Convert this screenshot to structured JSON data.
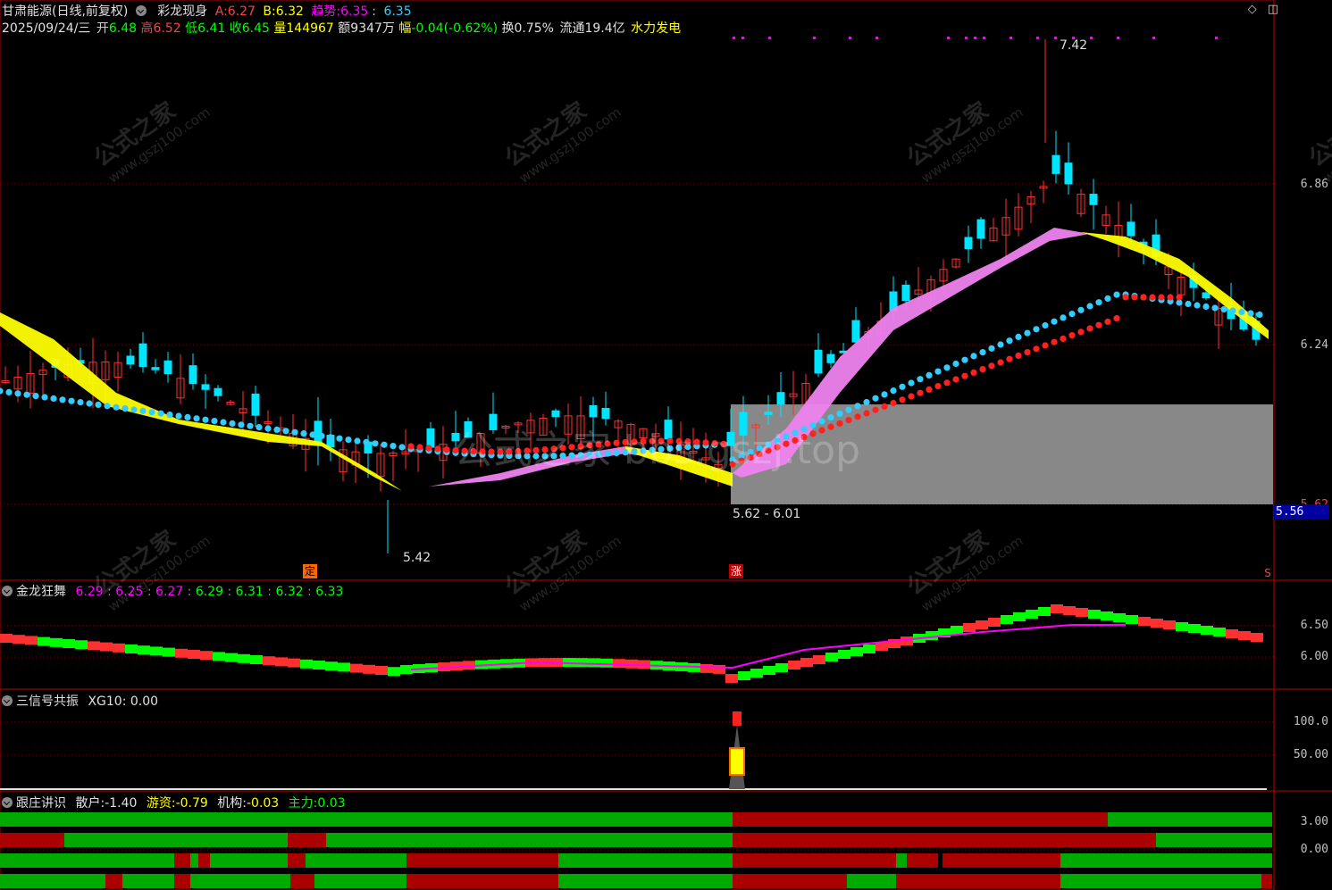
{
  "header": {
    "stock_name": "甘肃能源(日线,前复权)",
    "indicator": "彩龙现身",
    "a_label": "A:",
    "a_value": "6.27",
    "b_label": "B:",
    "b_value": "6.32",
    "trend_label": "趋势:",
    "trend_v1": "6.35",
    "trend_v2": "6.35",
    "date": "2025/09/24/三",
    "open_label": "开",
    "open": "6.48",
    "high_label": "高",
    "high": "6.52",
    "low_label": "低",
    "low": "6.41",
    "close_label": "收",
    "close": "6.45",
    "vol_label": "量",
    "vol": "144967",
    "amt": "额9347万",
    "chg_label": "幅",
    "chg": "-0.04(-0.62%)",
    "turnover": "换0.75%",
    "float": "流通19.4亿",
    "concept": "水力发电"
  },
  "main_axis": {
    "ticks": [
      "6.86",
      "6.24",
      "5.62"
    ],
    "current_price": "5.56"
  },
  "annotations": {
    "high_mark": "7.42",
    "low_mark": "5.42",
    "zone_label": "5.62 - 6.01",
    "signal_ding": "定",
    "signal_zhang": "涨",
    "signal_s": "S"
  },
  "watermarks": {
    "center": "公式之家 bbs.gszj.top",
    "tile_title": "公式之家",
    "tile_url": "www.gszj100.com"
  },
  "pane1": {
    "title": "金龙狂舞",
    "values": [
      "6.29",
      "6.25",
      "6.27",
      "6.29",
      "6.31",
      "6.32",
      "6.33"
    ],
    "ticks": [
      "6.50",
      "6.00"
    ]
  },
  "pane2": {
    "title": "三信号共振",
    "xg_label": "XG10:",
    "xg_value": "0.00",
    "ticks": [
      "100.0",
      "50.00"
    ]
  },
  "pane3": {
    "title": "跟庄讲识",
    "retail_label": "散户:",
    "retail_value": "-1.40",
    "hot_label": "游资:",
    "hot_value": "-0.79",
    "inst_label": "机构:",
    "inst_value": "-0.03",
    "main_label": "主力:",
    "main_value": "0.03",
    "ticks": [
      "3.00",
      "0.00"
    ]
  },
  "colors": {
    "up": "#ff3030",
    "down": "#00e5ff",
    "ma_yellow": "#ffff00",
    "ma_pink": "#ee82ee",
    "dot_blue": "#33ccff",
    "dot_red": "#ff2020",
    "bar_green": "#00aa00",
    "bar_red": "#aa0000"
  }
}
